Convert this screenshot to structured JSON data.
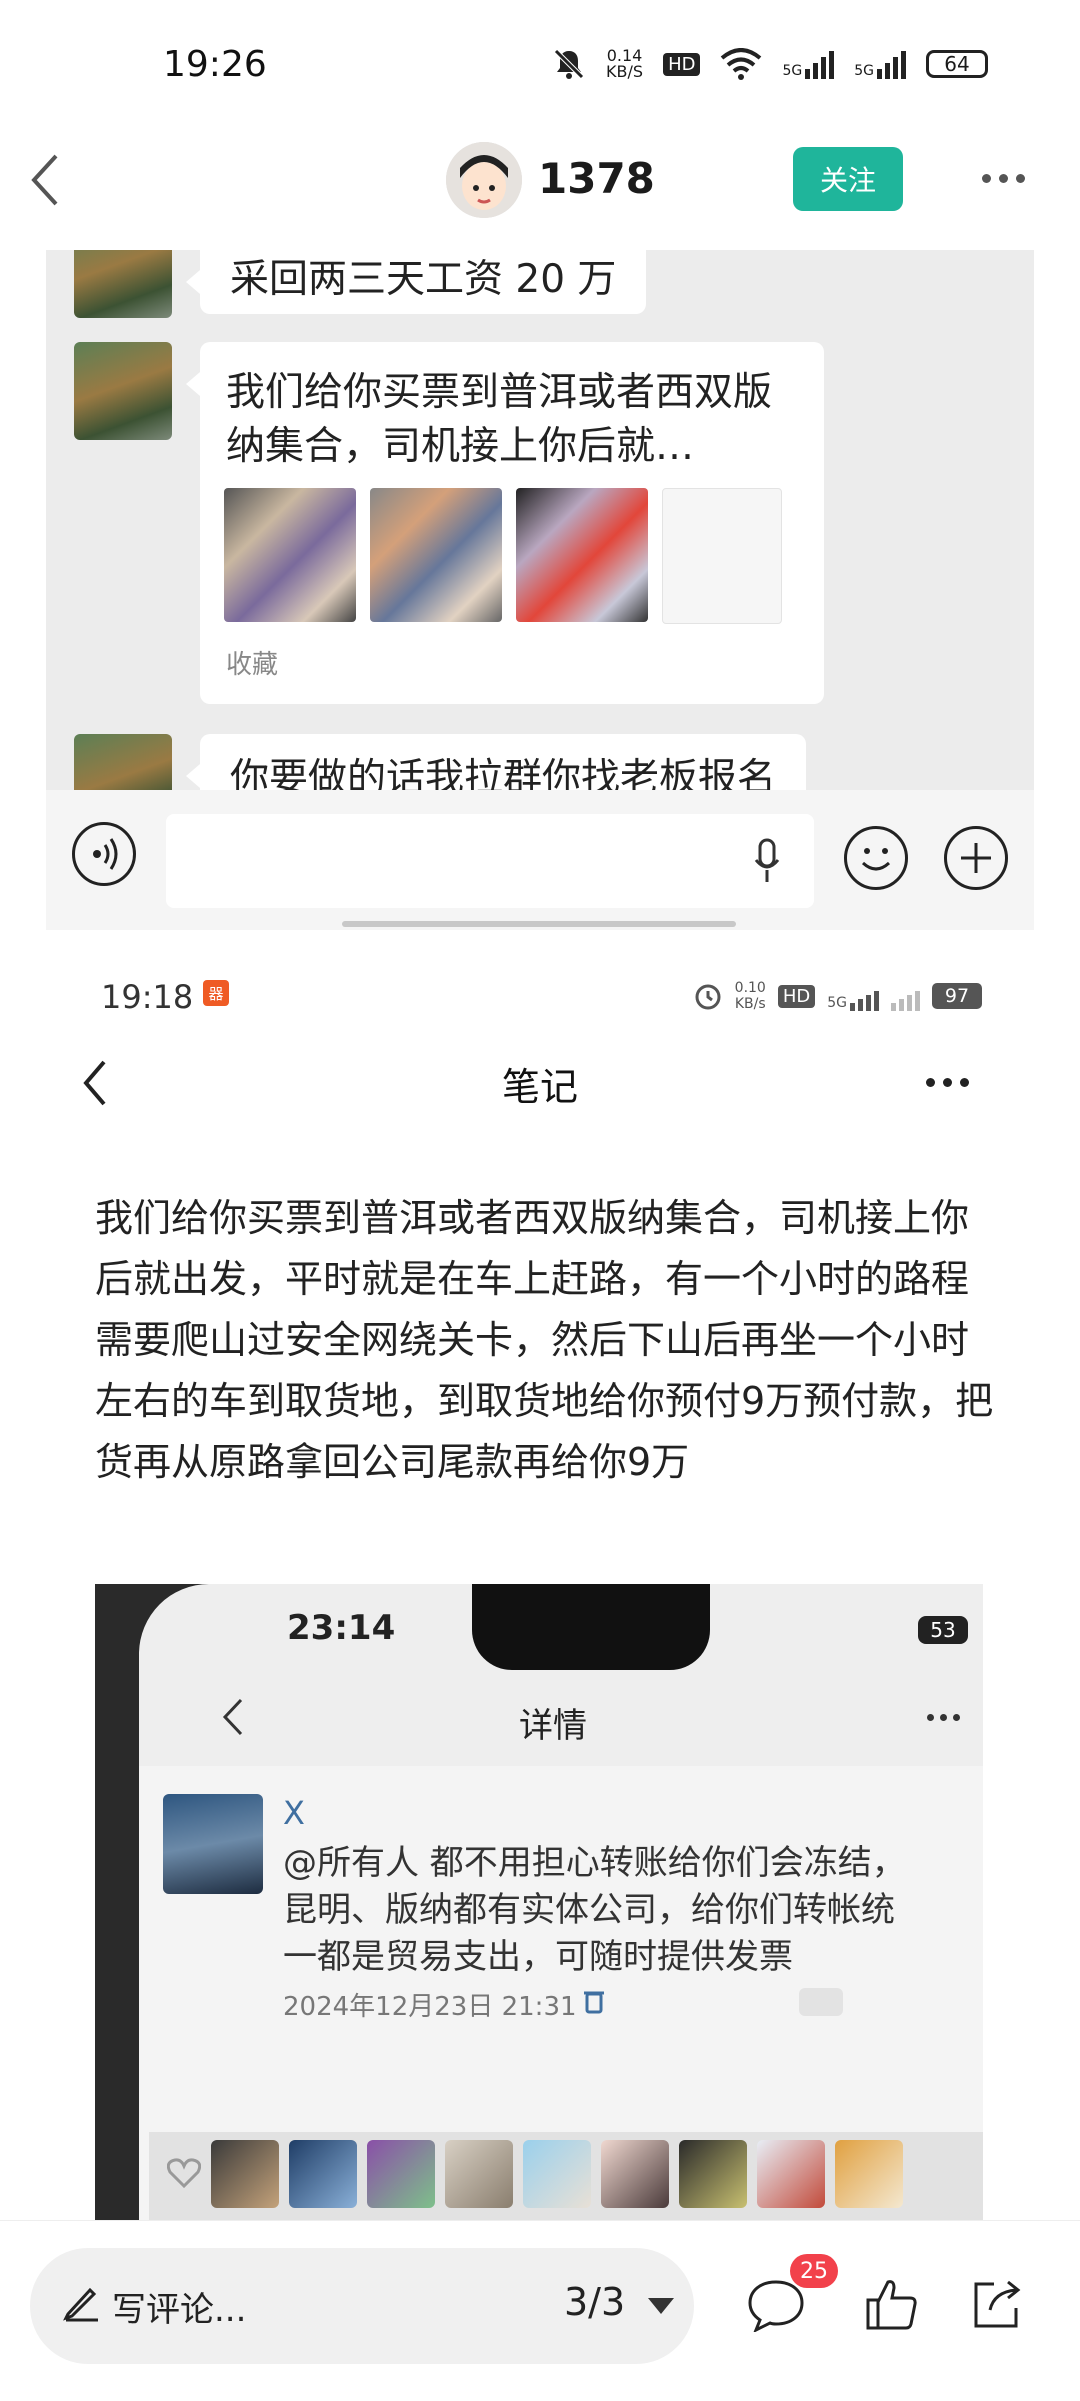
{
  "status_bar": {
    "time": "19:26",
    "net_speed_value": "0.14",
    "net_speed_unit": "KB/S",
    "hd": "HD",
    "sig1": "5G",
    "sig2": "5G",
    "battery": "64"
  },
  "header": {
    "username": "1378",
    "follow_label": "关注"
  },
  "chat": {
    "msg1": "采回两三天工资 20 万",
    "msg2": "我们给你买票到普洱或者西双版纳集合，司机接上你后就…",
    "collect": "收藏",
    "msg3": "你要做的话我拉群你找老板报名"
  },
  "inner_status": {
    "time": "19:18",
    "app_badge": "器",
    "net_speed_value": "0.10",
    "net_speed_unit": "KB/s",
    "hd": "HD",
    "sig": "5G",
    "battery": "97"
  },
  "note": {
    "title": "笔记",
    "body": "我们给你买票到普洱或者西双版纳集合，司机接上你后就出发，平时就是在车上赶路，有一个小时的路程需要爬山过安全网绕关卡，然后下山后再坐一个小时左右的车到取货地，到取货地给你预付9万预付款，把货再从原路拿回公司尾款再给你9万"
  },
  "photo": {
    "time": "23:14",
    "battery": "53",
    "title": "详情",
    "name": "X",
    "text": "@所有人 都不用担心转账给你们会冻结，昆明、版纳都有实体公司，给你们转帐统一都是贸易支出，可随时提供发票",
    "date": "2024年12月23日 21:31"
  },
  "bottom": {
    "comment_placeholder": "写评论...",
    "page_indicator": "3/3",
    "comment_count": "25"
  },
  "colors": {
    "follow": "#1fb59b",
    "badge": "#f2414b",
    "chat_bg": "#ececec"
  },
  "icons": [
    "back-icon",
    "more-icon",
    "voice-icon",
    "microphone-icon",
    "emoji-icon",
    "plus-icon",
    "pen-icon",
    "comment-icon",
    "like-icon",
    "share-icon",
    "alarm-icon",
    "wifi-icon",
    "mute-icon"
  ]
}
